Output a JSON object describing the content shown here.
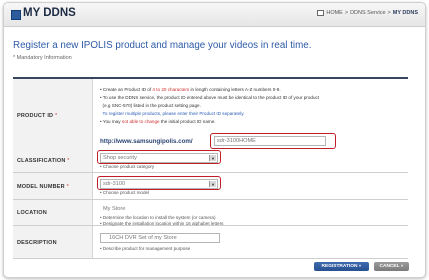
{
  "header": {
    "title": "MY DDNS",
    "breadcrumb": {
      "home": "HOME",
      "section": "DDNS Service",
      "current": "MY DDNS"
    }
  },
  "intro": {
    "headline": "Register a new IPOLIS product and manage your videos in real time.",
    "mandatory_note": "* Mandatory Information"
  },
  "form": {
    "product_id": {
      "label": "PRODUCT ID",
      "required_mark": "*",
      "notes": [
        "• Create an Product ID of 4 to 20 characters in length containing letters A-Z numbers 0-9.",
        "• To use the DDNS service, the product ID entered above must be identical to the product ID of your product",
        "(e.g SNC-570) listed in the product setting page.",
        "To register multiple products, please enter their Product ID separately.",
        "• You may not able to change the initial product ID name."
      ],
      "url_prefix": "http://www.samsungipolis.com/",
      "value": "sdr-3100HOME"
    },
    "classification": {
      "label": "CLASSIFICATION",
      "required_mark": "*",
      "value": "Shop security",
      "hint": "• Choose product category"
    },
    "model_number": {
      "label": "MODEL NUMBER",
      "required_mark": "*",
      "value": "sdr-3100",
      "hint": "• Choose product model"
    },
    "location": {
      "label": "LOCATION",
      "value": "My Store",
      "hints": [
        "• Determine the location to install the system (or camera)",
        "• Designate the installation location within 16 alphabet letters"
      ]
    },
    "description": {
      "label": "DESCRIPTION",
      "value": "16CH DVR Set of my Store",
      "hint": "• Describe product for management purpose"
    }
  },
  "buttons": {
    "register": "REGISTRATION »",
    "cancel": "CANCEL »"
  },
  "colors": {
    "highlight": "#c01f28",
    "accent": "#2d5aa6",
    "primary_button": "#2d5a9e"
  },
  "icons": {
    "title": "square-bullet-icon",
    "breadcrumb_home": "home-icon",
    "select": "dropdown-arrow-icon"
  }
}
